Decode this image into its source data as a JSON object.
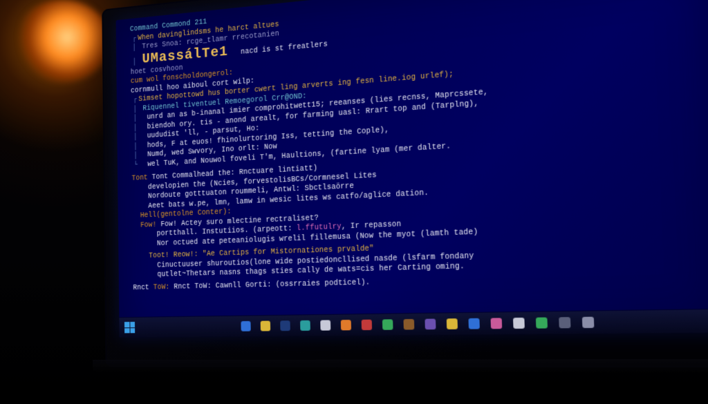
{
  "header_comment": "Command Commond 211",
  "big_word": "UMassálTe1",
  "big_word_trailer": "nacd is st freatlers",
  "lines": {
    "l1": "When davinglindsms he harct altues",
    "l2": "Tres Snoa: rcge_tlamr rrecotanien",
    "l3": "hoet cosvhoon",
    "l4": "cum wol fonscholdongerol:",
    "l5": "cornmull hoo aiboul cort wilp:",
    "l6": "Simset hopottowd hus borter cwert ling arverts ing fesn line.iog urlef);",
    "l7": "Riquennel tiventuel Remoegorol Crr@OND:",
    "l8": "unrd an as b-inanal imier comprohitwett15; reeanses (lies recnss, Maprcssete,",
    "l9": "biendoh ory. tis - anond arealt, for farming uasl: Rrart top and (Tarplng),",
    "l10": "uududist 'll, - parsut, Ho:",
    "l11": "hods, F at euos! fhinolurtoring Iss, tetting the Cople),",
    "l12": "Numd, wed Swvory, Ino orlt: Now",
    "l13": "wel TuK, and Nouwol foveli T'm, Haultions, (fartine lyam (mer dalter.",
    "l14": "Tont Commalhead the: Rnctuare lintiatt)",
    "l15": "developien the (Ncies, forvestolisBCs/Cormnesel Lites",
    "l16": "Nordoute gotttuaton roummeli, Antwl: Sbctlsaörre",
    "l17": "Aeet bats w.pe, lmn, lamw in wesic lites ws catfo/aglice dation.",
    "l18": "Hell(gentolne Conter):",
    "l19": "Fow! Actey suro mlectine rectraliset?",
    "l20a": "portthall. Instutiios. (arpeott: ",
    "l20b": "l.ffutulry",
    "l20c": ", Ir repasson",
    "l21": "Nor octued ate peteaniolugis wrelil fillemusa (Now the myot (lamth tade)",
    "l22": "Toot! Reow!: \"Ae Cartips for Mistornationes prvalde\"",
    "l23": "Cinuctuuser shuroutios(lone wide postiedoncllised nasde (lsfarm fondany",
    "l24": "qutlet~Thetars nasns thags sties cally de wats=cis her Carting oming.",
    "l25": "Rnct ToW: Cawnll Gorti: (ossrraies podticel)."
  },
  "taskbar": {
    "icons": [
      "edge",
      "explorer",
      "store",
      "mail",
      "chrome",
      "orange-app",
      "yellow-app",
      "green-app",
      "teal-app",
      "red-app",
      "folder",
      "purple-app",
      "word",
      "excel",
      "note",
      "white-app",
      "mic"
    ]
  }
}
